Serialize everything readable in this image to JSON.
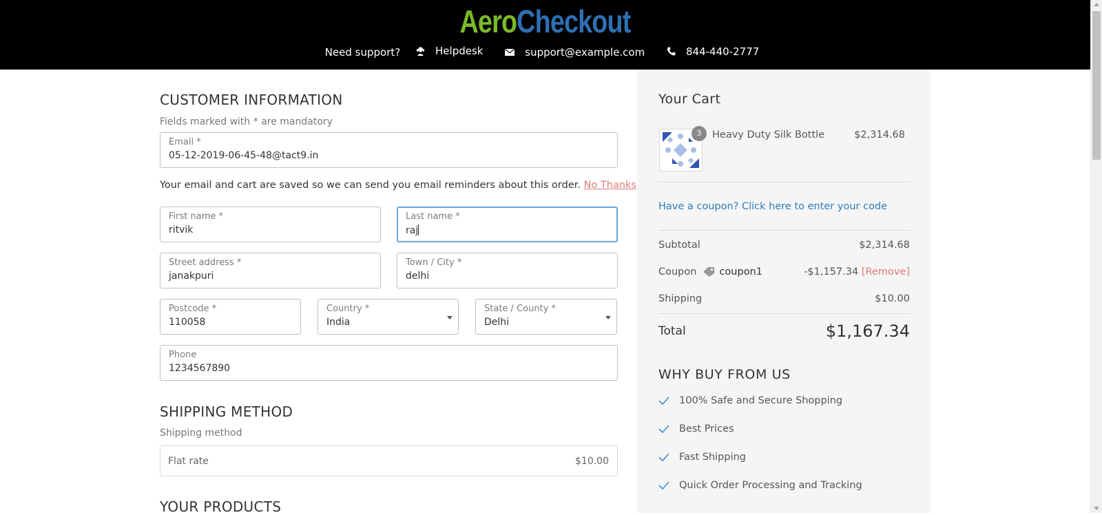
{
  "header": {
    "logo_part1": "Aero",
    "logo_part2": "Checkout",
    "support_label": "Need support?",
    "helpdesk_label": "Helpdesk",
    "email": "support@example.com",
    "phone": "844-440-2777",
    "colors": {
      "background": "#000000",
      "logo_green": "#7ab929",
      "logo_blue": "#2f6fb3"
    }
  },
  "customer": {
    "title": "CUSTOMER INFORMATION",
    "mandatory_note": "Fields marked with * are mandatory",
    "email": {
      "label": "Email *",
      "value": "05-12-2019-06-45-48@tact9.in"
    },
    "reminder_text": "Your email and cart are saved so we can send you email reminders about this order.",
    "no_thanks": "No Thanks",
    "first_name": {
      "label": "First name *",
      "value": "ritvik"
    },
    "last_name": {
      "label": "Last name *",
      "value": "raj"
    },
    "street": {
      "label": "Street address *",
      "value": "janakpuri"
    },
    "city": {
      "label": "Town / City *",
      "value": "delhi"
    },
    "postcode": {
      "label": "Postcode *",
      "value": "110058"
    },
    "country": {
      "label": "Country *",
      "value": "India"
    },
    "state": {
      "label": "State / County *",
      "value": "Delhi"
    },
    "phone": {
      "label": "Phone",
      "value": "1234567890"
    }
  },
  "shipping": {
    "title": "SHIPPING METHOD",
    "subtitle": "Shipping method",
    "method_label": "Flat rate",
    "method_price": "$10.00"
  },
  "products": {
    "title": "YOUR PRODUCTS"
  },
  "cart": {
    "title": "Your Cart",
    "item": {
      "name": "Heavy Duty Silk Bottle",
      "price": "$2,314.68",
      "quantity": "3",
      "image_icon": "product-pattern-icon"
    },
    "coupon_link": "Have a coupon? Click here to enter your code",
    "subtotal_label": "Subtotal",
    "subtotal_value": "$2,314.68",
    "coupon_label": "Coupon",
    "coupon_code": "coupon1",
    "coupon_value": "-$1,157.34",
    "coupon_remove": "[Remove]",
    "shipping_label": "Shipping",
    "shipping_value": "$10.00",
    "total_label": "Total",
    "total_value": "$1,167.34"
  },
  "why": {
    "title": "WHY BUY FROM US",
    "items": [
      "100% Safe and Secure Shopping",
      "Best Prices",
      "Fast Shipping",
      "Quick Order Processing and Tracking"
    ]
  }
}
